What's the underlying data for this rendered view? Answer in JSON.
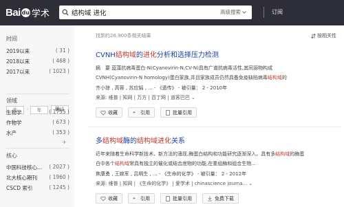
{
  "header": {
    "logo_text": "Bai",
    "logo_paw": "du",
    "logo_suffix": "学术",
    "search_value": "结构域 进化",
    "advanced_search": "高级搜索",
    "subscribe": "订阅"
  },
  "sidebar": {
    "time": {
      "title": "时间",
      "items": [
        {
          "label": "2019以来",
          "count": "( 31 )"
        },
        {
          "label": "2018以来",
          "count": "( 468 )"
        },
        {
          "label": "2017以来",
          "count": "( 1023 )"
        }
      ],
      "year_from_placeholder": "年",
      "year_to_placeholder": "年",
      "dash": "-",
      "confirm_label": "确认"
    },
    "field": {
      "title": "领域",
      "items": [
        {
          "label": "生物学",
          "count": "( 1755 )"
        },
        {
          "label": "作物学",
          "count": "( 673 )"
        },
        {
          "label": "水产",
          "count": "( 353 )"
        }
      ],
      "more": "+"
    },
    "core": {
      "title": "核心",
      "items": [
        {
          "label": "中国科技核心...",
          "count": "( 2027 )"
        },
        {
          "label": "北大核心期刊",
          "count": "( 1960 )"
        },
        {
          "label": "CSCD 索引",
          "count": "( 1245 )"
        }
      ]
    }
  },
  "main": {
    "found_text": "找到约26,900条相关结果",
    "sort_label": "按相关性",
    "results": [
      {
        "title_pre": "CVNH",
        "title_hl1": "结构域",
        "title_mid": "的",
        "title_hl2": "进化",
        "title_post": "分析和选择压力检测",
        "abstract_1": "摘　要  蓝藻抗病毒蛋白-N(Cyanovirin-N,CV-N)具有广谱抗病毒活性,其同源物构成",
        "abstract_2_pre": "CVNH(Cyanovirin-N homology)蛋白家族,并且家族成员仍然具备免疫缺陷病毒",
        "abstract_2_hl": "结构域",
        "abstract_2_post": "的",
        "authors": "齐小琼 ,  高蓉 ,  苏应娟 , ... - 《遗传》 - 被引量： 2 - 2010年",
        "source": "来源:  维普  |  知网  |  万方  |  百丁网  |  道客巴巴  ⌄",
        "buttons": [
          "收藏",
          "引用",
          "批量引用"
        ]
      },
      {
        "title_pre": "多",
        "title_hl1": "结构域",
        "title_mid": "酶的",
        "title_hl2": "结构域进化",
        "title_post": "关系",
        "abstract_1": "近年来随着生命科学新技术、新方法的涌现,酶蛋白结构和功能研究逐渐深入。具有多",
        "abstract_1_hl": "结构域",
        "abstract_1_post": "的酶蛋",
        "abstract_2_pre": "白中各个",
        "abstract_2_hl": "结构域",
        "abstract_2_post": "常具有独立的催化或结合底物的功能,在重组酶和组合生物...",
        "authors": "焦康勇 ,  王婉军 ,  吕明生 ,  ... - 《生命的化学》 - 被引量： 2 - 2012年",
        "source": "来源:  维普  |  知网  |  《生命的化学》  |  爱学术  |  chinascience journa...  ⌄",
        "buttons": [
          "收藏",
          "引用",
          "批量引用",
          "免费下载"
        ]
      }
    ]
  },
  "colors": {
    "header_bg": "#2e2e38",
    "link_blue": "#1a3fa6",
    "highlight_red": "#c0392b"
  }
}
